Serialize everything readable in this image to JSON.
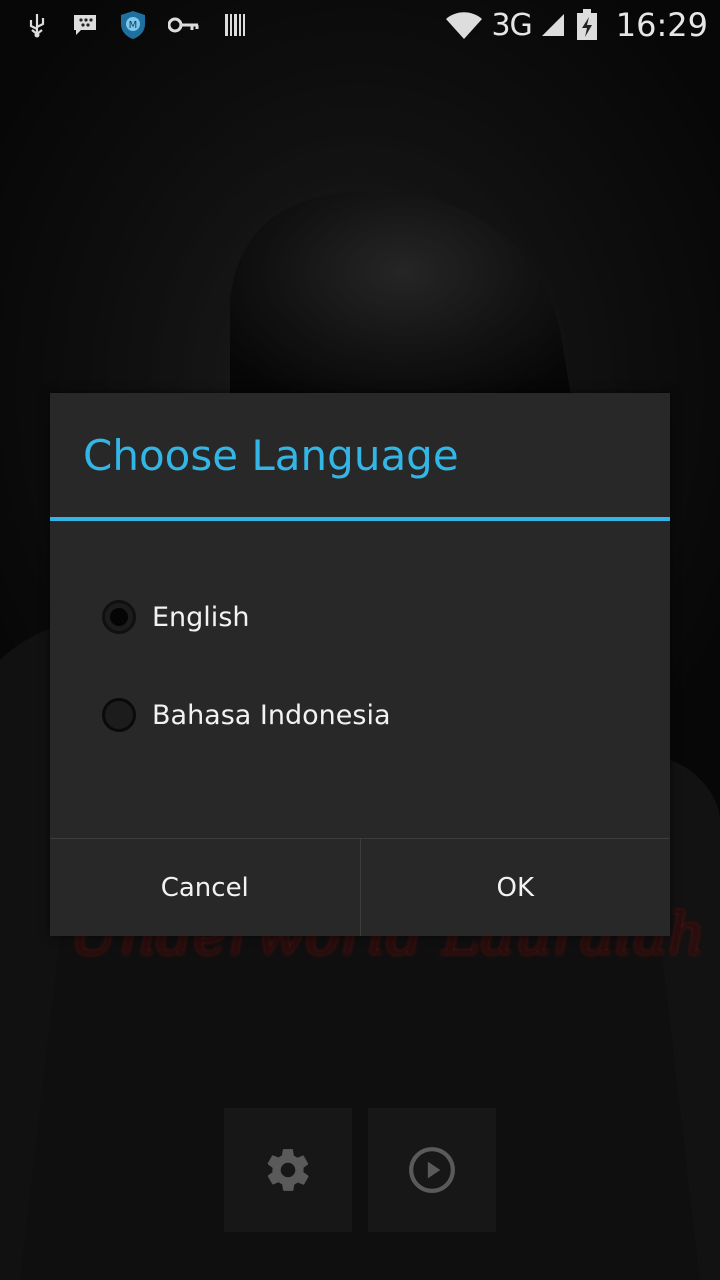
{
  "status_bar": {
    "icons_left": [
      "usb-icon",
      "bbm-icon",
      "shield-app-icon",
      "key-icon",
      "barcode-icon"
    ],
    "network_type": "3G",
    "time": "16:29",
    "icons_right": [
      "wifi-icon",
      "signal-icon",
      "battery-charging-icon"
    ]
  },
  "background": {
    "game_title": "Underworld Lauralah",
    "settings_button_icon": "gear-icon",
    "play_button_icon": "play-circle-icon"
  },
  "dialog": {
    "title": "Choose Language",
    "options": [
      {
        "label": "English",
        "selected": true
      },
      {
        "label": "Bahasa Indonesia",
        "selected": false
      }
    ],
    "cancel_label": "Cancel",
    "ok_label": "OK"
  },
  "colors": {
    "accent": "#33b5e5",
    "dialog_bg": "#282828"
  }
}
